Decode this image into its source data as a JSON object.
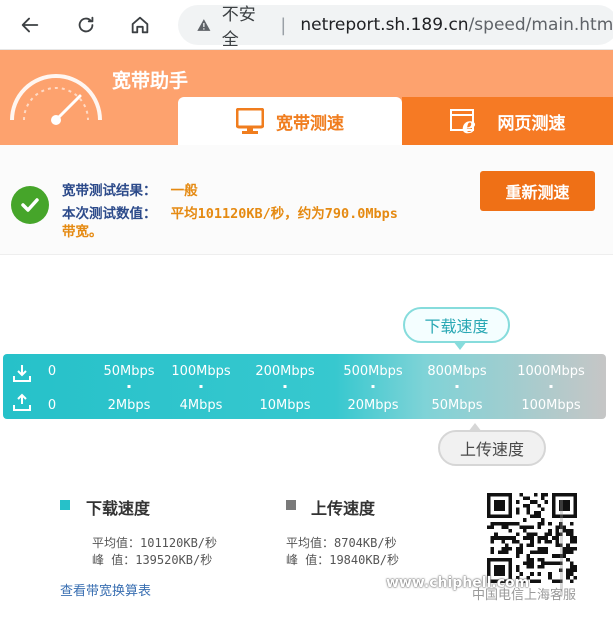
{
  "browser": {
    "security_label": "不安全",
    "host": "netreport.sh.189.cn",
    "path": "/speed/main.html"
  },
  "header": {
    "app_title": "宽带助手",
    "tabs": [
      {
        "label": "宽带测速",
        "icon": "monitor-icon",
        "active": true
      },
      {
        "label": "网页测速",
        "icon": "browser-e-icon",
        "active": false
      }
    ]
  },
  "result": {
    "label1": "宽带测试结果：",
    "value1": "一般",
    "label2": "本次测试数值：",
    "value2_line1": "平均101120KB/秒，约为790.0Mbps",
    "value2_line2": "带宽。",
    "retest_label": "重新测速"
  },
  "scale": {
    "download_bubble": "下载速度",
    "upload_bubble": "上传速度",
    "download_ticks": [
      "0",
      "50Mbps",
      "100Mbps",
      "200Mbps",
      "500Mbps",
      "800Mbps",
      "1000Mbps"
    ],
    "upload_ticks": [
      "0",
      "2Mbps",
      "4Mbps",
      "10Mbps",
      "20Mbps",
      "50Mbps",
      "100Mbps"
    ]
  },
  "stats": {
    "download": {
      "title": "下载速度",
      "avg": "平均值：101120KB/秒",
      "peak": "峰  值：139520KB/秒"
    },
    "upload": {
      "title": "上传速度",
      "avg": "平均值：8704KB/秒",
      "peak": "峰  值：19840KB/秒"
    }
  },
  "link_label": "查看带宽换算表",
  "watermark": "www.chiphell.com",
  "corp_label": "中国电信上海客服",
  "colors": {
    "header_orange": "#fda26e",
    "accent_orange": "#ef7016",
    "teal": "#26c1c9",
    "check_green": "#46a52a",
    "label_blue": "#2c4a8a",
    "value_orange": "#e58a12"
  }
}
